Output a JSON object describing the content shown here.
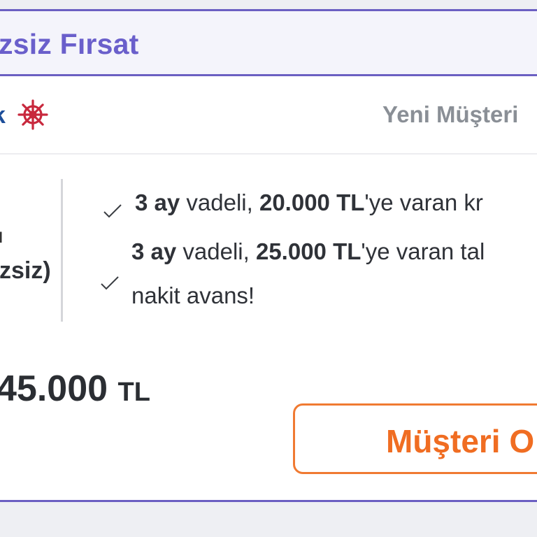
{
  "offer": {
    "title": "zsiz Fırsat"
  },
  "bank": {
    "logo_text": "k",
    "logo_icon": "ship-helm-icon",
    "brand_color": "#1d4e9a",
    "icon_color": "#c8283d",
    "segment": "Yeni Müşteri"
  },
  "product": {
    "line1": "ı",
    "line2": "zsiz)"
  },
  "features": [
    {
      "icon": "checkmark-icon",
      "p1": "3 ay",
      "p2": " vadeli, ",
      "p3": "20.000 TL",
      "p4": "'ye varan kr"
    },
    {
      "icon": "checkmark-icon",
      "p1": "3 ay",
      "p2": " vadeli, ",
      "p3": "25.000 TL",
      "p4": "'ye varan tal",
      "p5": "nakit avans!"
    }
  ],
  "limit": {
    "amount": "45.000",
    "currency": "TL"
  },
  "cta": {
    "label": "Müşteri O"
  },
  "colors": {
    "accent": "#6b5fc2",
    "cta": "#f06d22"
  }
}
